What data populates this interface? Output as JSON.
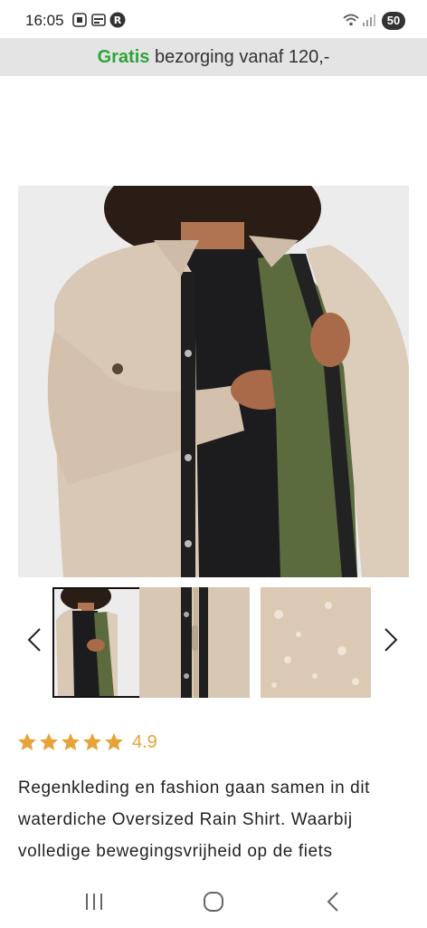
{
  "status_bar": {
    "time": "16:05",
    "battery": "50",
    "icons": [
      "screenshot-icon",
      "gallery-icon",
      "r-app-icon",
      "wifi-icon",
      "signal-icon"
    ]
  },
  "promo": {
    "highlight": "Gratis",
    "text": " bezorging vanaf 120,-",
    "highlight_color": "#2fa43a"
  },
  "product": {
    "main_image": "rain-shirt-model-image",
    "thumbnails": [
      "thumb-model",
      "thumb-placket-detail",
      "thumb-water-drops"
    ],
    "active_thumbnail": 0
  },
  "rating": {
    "stars": 5,
    "value": "4.9",
    "star_color": "#e8a23a"
  },
  "description": {
    "line1": "Regenkleding en fashion gaan samen in dit",
    "line2": "waterdiche Oversized Rain Shirt. Waarbij",
    "line3": "volledige bewegingsvrijheid op de fiets"
  },
  "navbar": {
    "icons": [
      "recent-apps-icon",
      "home-icon",
      "back-icon"
    ]
  }
}
